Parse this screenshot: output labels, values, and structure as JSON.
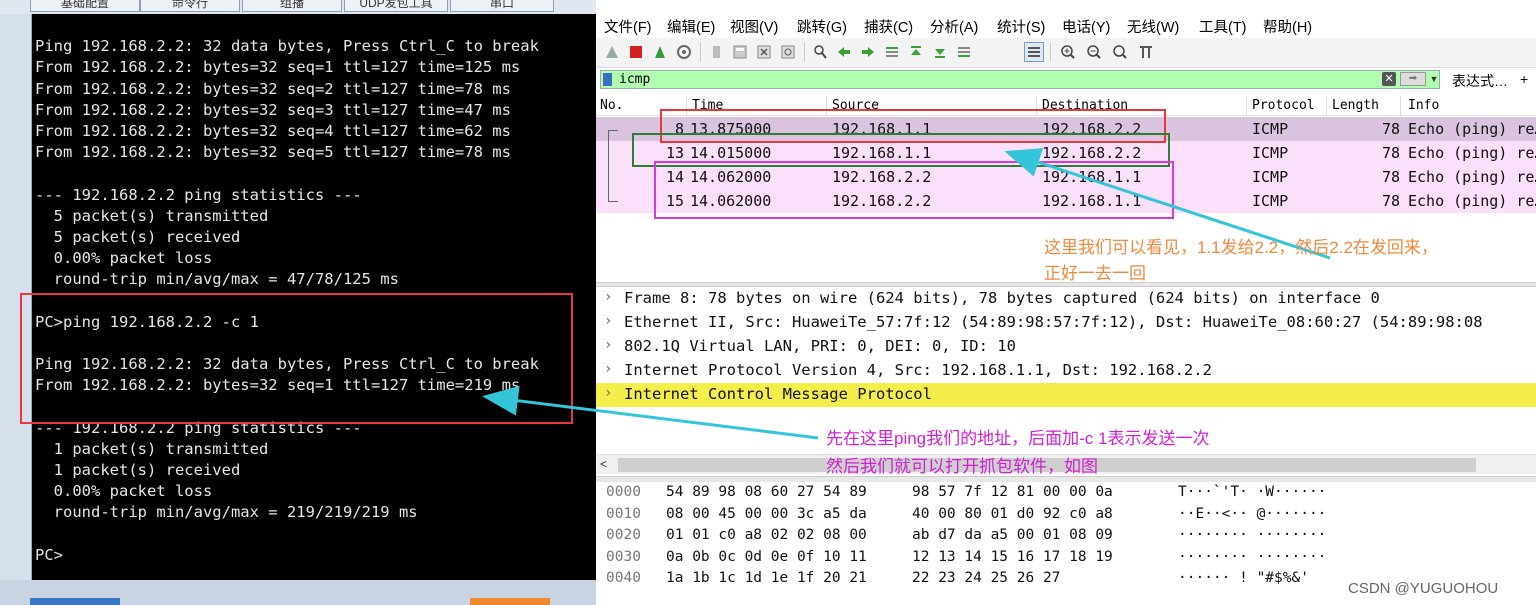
{
  "terminal": {
    "tabs": [
      "基础配置",
      "命令行",
      "组播",
      "UDP发包工具",
      "串口"
    ],
    "lines": [
      "",
      "Ping 192.168.2.2: 32 data bytes, Press Ctrl_C to break",
      "From 192.168.2.2: bytes=32 seq=1 ttl=127 time=125 ms",
      "From 192.168.2.2: bytes=32 seq=2 ttl=127 time=78 ms",
      "From 192.168.2.2: bytes=32 seq=3 ttl=127 time=47 ms",
      "From 192.168.2.2: bytes=32 seq=4 ttl=127 time=62 ms",
      "From 192.168.2.2: bytes=32 seq=5 ttl=127 time=78 ms",
      "",
      "--- 192.168.2.2 ping statistics ---",
      "  5 packet(s) transmitted",
      "  5 packet(s) received",
      "  0.00% packet loss",
      "  round-trip min/avg/max = 47/78/125 ms",
      "",
      "PC>ping 192.168.2.2 -c 1",
      "",
      "Ping 192.168.2.2: 32 data bytes, Press Ctrl_C to break",
      "From 192.168.2.2: bytes=32 seq=1 ttl=127 time=219 ms",
      "",
      "--- 192.168.2.2 ping statistics ---",
      "  1 packet(s) transmitted",
      "  1 packet(s) received",
      "  0.00% packet loss",
      "  round-trip min/avg/max = 219/219/219 ms",
      "",
      "PC>"
    ]
  },
  "wireshark": {
    "menu": [
      "文件(F)",
      "编辑(E)",
      "视图(V)",
      "跳转(G)",
      "捕获(C)",
      "分析(A)",
      "统计(S)",
      "电话(Y)",
      "无线(W)",
      "工具(T)",
      "帮助(H)"
    ],
    "filter": {
      "value": "icmp",
      "expression_label": "表达式…",
      "plus_label": "+"
    },
    "columns": [
      "No.",
      "Time",
      "Source",
      "Destination",
      "Protocol",
      "Length",
      "Info"
    ],
    "packets": [
      {
        "no": "8",
        "time": "13.875000",
        "source": "192.168.1.1",
        "destination": "192.168.2.2",
        "protocol": "ICMP",
        "length": "78",
        "info": "Echo (ping) re…",
        "bg": "#d9c3df"
      },
      {
        "no": "13",
        "time": "14.015000",
        "source": "192.168.1.1",
        "destination": "192.168.2.2",
        "protocol": "ICMP",
        "length": "78",
        "info": "Echo (ping) re…",
        "bg": "#fbe0fb"
      },
      {
        "no": "14",
        "time": "14.062000",
        "source": "192.168.2.2",
        "destination": "192.168.1.1",
        "protocol": "ICMP",
        "length": "78",
        "info": "Echo (ping) re…",
        "bg": "#fbe0fb"
      },
      {
        "no": "15",
        "time": "14.062000",
        "source": "192.168.2.2",
        "destination": "192.168.1.1",
        "protocol": "ICMP",
        "length": "78",
        "info": "Echo (ping) re…",
        "bg": "#fbe0fb"
      }
    ],
    "details": [
      "Frame 8: 78 bytes on wire (624 bits), 78 bytes captured (624 bits) on interface 0",
      "Ethernet II, Src: HuaweiTe_57:7f:12 (54:89:98:57:7f:12), Dst: HuaweiTe_08:60:27 (54:89:98:08",
      "802.1Q Virtual LAN, PRI: 0, DEI: 0, ID: 10",
      "Internet Protocol Version 4, Src: 192.168.1.1, Dst: 192.168.2.2",
      "Internet Control Message Protocol"
    ],
    "hex": [
      {
        "offset": "0000",
        "b1": "54 89 98 08 60 27 54 89",
        "b2": "98 57 7f 12 81 00 00 0a",
        "ascii": "T···`'T· ·W······"
      },
      {
        "offset": "0010",
        "b1": "08 00 45 00 00 3c a5 da",
        "b2": "40 00 80 01 d0 92 c0 a8",
        "ascii": "··E··<·· @·······"
      },
      {
        "offset": "0020",
        "b1": "01 01 c0 a8 02 02 08 00",
        "b2": "ab d7 da a5 00 01 08 09",
        "ascii": "········ ········"
      },
      {
        "offset": "0030",
        "b1": "0a 0b 0c 0d 0e 0f 10 11",
        "b2": "12 13 14 15 16 17 18 19",
        "ascii": "········ ········"
      },
      {
        "offset": "0040",
        "b1": "1a 1b 1c 1d 1e 1f 20 21",
        "b2": "22 23 24 25 26 27",
        "ascii": "······ ! \"#$%&'"
      }
    ]
  },
  "annotations": {
    "note_top_line1": "这里我们可以看见，1.1发给2.2，然后2.2在发回来，",
    "note_top_line2": "正好一去一回",
    "note_bottom_line1": "先在这里ping我们的地址，后面加-c 1表示发送一次",
    "note_bottom_line2": "然后我们就可以打开抓包软件，如图",
    "colors": {
      "red": "#e8383d",
      "green": "#2e7d32",
      "magenta": "#d63bd6",
      "arrow": "#34c6d8",
      "note_top": "#ef8a3c",
      "note_bottom": "#d11fd1"
    }
  },
  "watermark": "CSDN @YUGUOHOU"
}
